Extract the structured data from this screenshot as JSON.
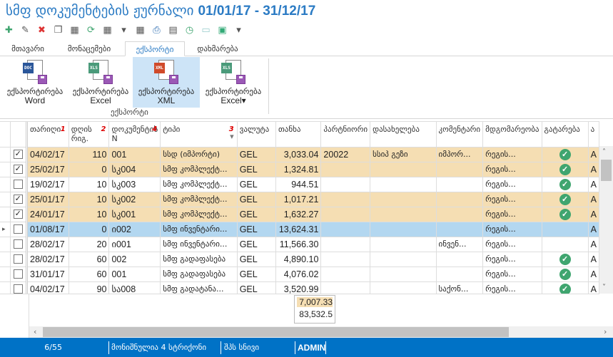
{
  "window": {
    "title": "სმფ დოკუმენტების ჟურნალი",
    "period": "01/01/17 - 31/12/17"
  },
  "toolbar": [
    {
      "icon": "plus-icon",
      "color": "#3fa56f",
      "g": "✚"
    },
    {
      "icon": "edit-icon",
      "color": "#555",
      "g": "✎"
    },
    {
      "icon": "delete-icon",
      "color": "#d33",
      "g": "✖"
    },
    {
      "icon": "copy-icon",
      "color": "#555",
      "g": "❐"
    },
    {
      "icon": "table-refresh-icon",
      "color": "#555",
      "g": "▦"
    },
    {
      "icon": "refresh-icon",
      "color": "#3fa56f",
      "g": "⟳"
    },
    {
      "icon": "table-xls-icon",
      "color": "#555",
      "g": "▦"
    },
    {
      "icon": "dropdown-icon",
      "color": "#555",
      "g": "▾"
    },
    {
      "icon": "table-search-icon",
      "color": "#555",
      "g": "▦"
    },
    {
      "icon": "print-icon",
      "color": "#2b6cb0",
      "g": "⎙"
    },
    {
      "icon": "xls-icon",
      "color": "#555",
      "g": "▤"
    },
    {
      "icon": "history-icon",
      "color": "#3fa56f",
      "g": "◷"
    },
    {
      "icon": "layout-icon",
      "color": "#9cc",
      "g": "▭"
    },
    {
      "icon": "layout-alt-icon",
      "color": "#3a7",
      "g": "▣"
    },
    {
      "icon": "more-icon",
      "color": "#555",
      "g": "▾"
    }
  ],
  "tabs": [
    "მთავარი",
    "მონაცემები",
    "ექსპორტი",
    "დახმარება"
  ],
  "active_tab": 2,
  "ribbon": {
    "buttons": [
      {
        "label": "ექსპორტირება",
        "sub": "Word",
        "badge": "DOC",
        "color": "#2b579a"
      },
      {
        "label": "ექსპორტირება",
        "sub": "Excel",
        "badge": "XLS",
        "color": "#4a9a7a"
      },
      {
        "label": "ექსპორტირება",
        "sub": "XML",
        "badge": "XML",
        "color": "#d04a2a"
      },
      {
        "label": "ექსპორტირება",
        "sub": "Excel▾",
        "badge": "XLS",
        "color": "#4a9a7a"
      }
    ],
    "group": "ექსპორტი"
  },
  "grid": {
    "columns": [
      {
        "label": "თარიღი",
        "sort": "1"
      },
      {
        "label": "დღის რიგ.",
        "sort": "2"
      },
      {
        "label": "დოკუმენტის N",
        "sort": "4"
      },
      {
        "label": "ტიპი",
        "sort": "3"
      },
      {
        "label": "ვალუტა"
      },
      {
        "label": "თანხა"
      },
      {
        "label": "პარტნიორი"
      },
      {
        "label": "დასახელება"
      },
      {
        "label": "კომენტარი"
      },
      {
        "label": "მდგომარეობა"
      },
      {
        "label": "გატარება"
      },
      {
        "label": "ა"
      }
    ],
    "rows": [
      {
        "checked": true,
        "date": "04/02/17",
        "day": "110",
        "doc": "001",
        "type": "სსდ (იმპორტი)",
        "cur": "GEL",
        "amount": "3,033.04",
        "partner": "20022",
        "name": "სსიპ გეზი",
        "comment": "იმპორ...",
        "status": "რეგის...",
        "posted": true,
        "last": "A"
      },
      {
        "checked": true,
        "date": "25/02/17",
        "day": "0",
        "doc": "სკ004",
        "type": "სმფ კომპლექტ...",
        "cur": "GEL",
        "amount": "1,324.81",
        "partner": "",
        "name": "",
        "comment": "",
        "status": "რეგის...",
        "posted": true,
        "last": "A"
      },
      {
        "checked": false,
        "date": "19/02/17",
        "day": "10",
        "doc": "სკ003",
        "type": "სმფ კომპლექტ...",
        "cur": "GEL",
        "amount": "944.51",
        "partner": "",
        "name": "",
        "comment": "",
        "status": "რეგის...",
        "posted": true,
        "last": "A"
      },
      {
        "checked": true,
        "date": "25/01/17",
        "day": "10",
        "doc": "სკ002",
        "type": "სმფ კომპლექტ...",
        "cur": "GEL",
        "amount": "1,017.21",
        "partner": "",
        "name": "",
        "comment": "",
        "status": "რეგის...",
        "posted": true,
        "last": "A"
      },
      {
        "checked": true,
        "date": "24/01/17",
        "day": "10",
        "doc": "სკ001",
        "type": "სმფ კომპლექტ...",
        "cur": "GEL",
        "amount": "1,632.27",
        "partner": "",
        "name": "",
        "comment": "",
        "status": "რეგის...",
        "posted": true,
        "last": "A"
      },
      {
        "checked": false,
        "current": true,
        "date": "01/08/17",
        "day": "0",
        "doc": "ი002",
        "type": "სმფ ინვენტარი...",
        "cur": "GEL",
        "amount": "13,624.31",
        "partner": "",
        "name": "",
        "comment": "",
        "status": "რეგის...",
        "posted": false,
        "last": "A"
      },
      {
        "checked": false,
        "date": "28/02/17",
        "day": "20",
        "doc": "ი001",
        "type": "სმფ ინვენტარი...",
        "cur": "GEL",
        "amount": "11,566.30",
        "partner": "",
        "name": "",
        "comment": "ინვენ...",
        "status": "რეგის...",
        "posted": false,
        "last": "A"
      },
      {
        "checked": false,
        "date": "28/02/17",
        "day": "60",
        "doc": "002",
        "type": "სმფ გადაფასება",
        "cur": "GEL",
        "amount": "4,890.10",
        "partner": "",
        "name": "",
        "comment": "",
        "status": "რეგის...",
        "posted": true,
        "last": "A"
      },
      {
        "checked": false,
        "date": "31/01/17",
        "day": "60",
        "doc": "001",
        "type": "სმფ გადაფასება",
        "cur": "GEL",
        "amount": "4,076.02",
        "partner": "",
        "name": "",
        "comment": "",
        "status": "რეგის...",
        "posted": true,
        "last": "A"
      },
      {
        "checked": false,
        "date": "04/02/17",
        "day": "90",
        "doc": "სა008",
        "type": "სმფ გადატანა...",
        "cur": "GEL",
        "amount": "3,520.99",
        "partner": "",
        "name": "",
        "comment": "საქონ...",
        "status": "რეგის...",
        "posted": true,
        "last": "A"
      }
    ],
    "summary": {
      "selected_total": "7,007.33",
      "total": "83,532.5"
    }
  },
  "statusbar": {
    "position": "6/55",
    "selected": "მონიშნულია 4 სტრიქონი",
    "company": "შპს სნივი",
    "user": "ADMIN"
  },
  "colors": {
    "accent": "#0072c6",
    "marked_row": "#f5deb3",
    "current_row": "#b3d7f0",
    "posted": "#3fa56f"
  }
}
